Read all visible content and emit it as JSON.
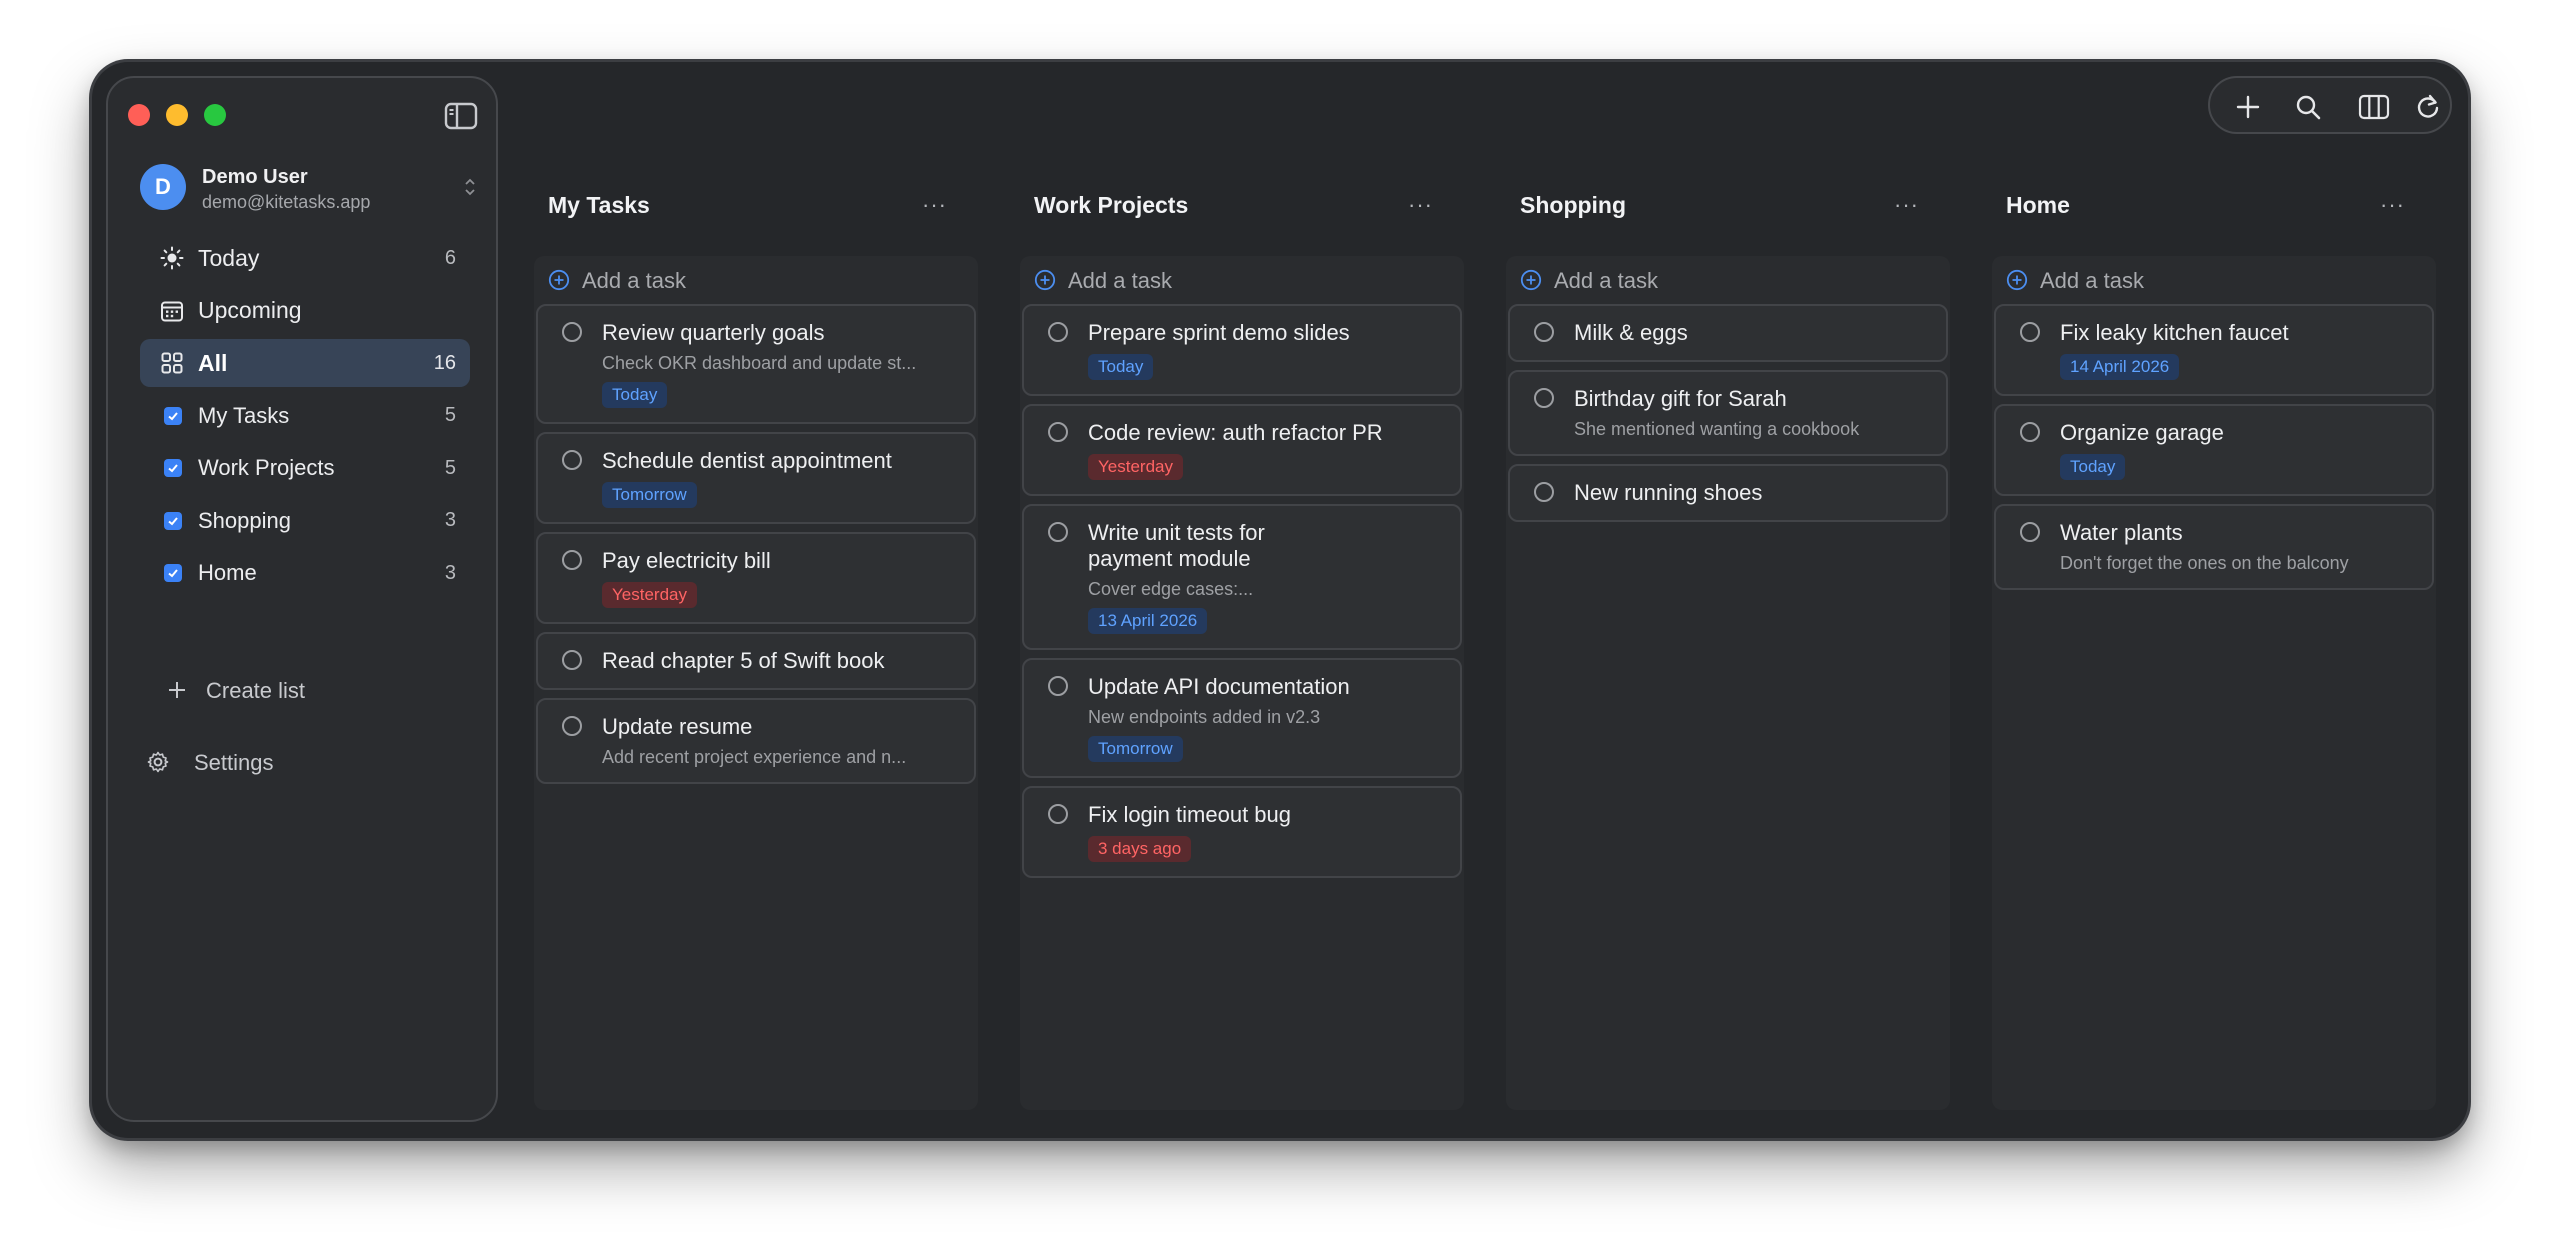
{
  "sidebar": {
    "account": {
      "initial": "D",
      "name": "Demo User",
      "email": "demo@kitetasks.app"
    },
    "smart_lists": [
      {
        "label": "Today",
        "count": "6",
        "icon": "sun-icon"
      },
      {
        "label": "Upcoming",
        "count": "",
        "icon": "calendar-icon"
      },
      {
        "label": "All",
        "count": "16",
        "icon": "grid-icon",
        "active": true
      }
    ],
    "lists": [
      {
        "label": "My Tasks",
        "count": "5"
      },
      {
        "label": "Work Projects",
        "count": "5"
      },
      {
        "label": "Shopping",
        "count": "3"
      },
      {
        "label": "Home",
        "count": "3"
      }
    ],
    "create_list": "Create list",
    "settings": "Settings"
  },
  "toolbar": {
    "icons": [
      "plus-icon",
      "search-icon",
      "columns-icon",
      "refresh-icon"
    ]
  },
  "colors": {
    "accent": "#3b82f6",
    "badge_blue": "#5fa2ff",
    "badge_red": "#ff6464",
    "avatar": "#4c8ef0"
  },
  "columns": [
    {
      "title": "My Tasks",
      "more": "···",
      "add_task": "Add a task",
      "tasks": [
        {
          "title": "Review quarterly goals",
          "note": "Check OKR dashboard and update st...",
          "badge": "Today",
          "badge_color": "blue"
        },
        {
          "title": "Schedule dentist appointment",
          "note": "",
          "badge": "Tomorrow",
          "badge_color": "blue"
        },
        {
          "title": "Pay electricity bill",
          "note": "",
          "badge": "Yesterday",
          "badge_color": "red"
        },
        {
          "title": "Read chapter 5 of Swift book",
          "note": "",
          "badge": "",
          "badge_color": ""
        },
        {
          "title": "Update resume",
          "note": "Add recent project experience and n...",
          "badge": "",
          "badge_color": ""
        }
      ]
    },
    {
      "title": "Work Projects",
      "more": "···",
      "add_task": "Add a task",
      "tasks": [
        {
          "title": "Prepare sprint demo slides",
          "note": "",
          "badge": "Today",
          "badge_color": "blue"
        },
        {
          "title": "Code review: auth refactor PR",
          "note": "",
          "badge": "Yesterday",
          "badge_color": "red"
        },
        {
          "title": "Write unit tests for\npayment module",
          "note": "Cover edge cases:...",
          "badge": "13 April 2026",
          "badge_color": "blue"
        },
        {
          "title": "Update API documentation",
          "note": "New endpoints added in v2.3",
          "badge": "Tomorrow",
          "badge_color": "blue"
        },
        {
          "title": "Fix login timeout bug",
          "note": "",
          "badge": "3 days ago",
          "badge_color": "red"
        }
      ]
    },
    {
      "title": "Shopping",
      "more": "···",
      "add_task": "Add a task",
      "tasks": [
        {
          "title": "Milk & eggs",
          "note": "",
          "badge": "",
          "badge_color": ""
        },
        {
          "title": "Birthday gift for Sarah",
          "note": "She mentioned wanting a cookbook",
          "badge": "",
          "badge_color": ""
        },
        {
          "title": "New running shoes",
          "note": "",
          "badge": "",
          "badge_color": ""
        }
      ]
    },
    {
      "title": "Home",
      "more": "···",
      "add_task": "Add a task",
      "tasks": [
        {
          "title": "Fix leaky kitchen faucet",
          "note": "",
          "badge": "14 April 2026",
          "badge_color": "blue"
        },
        {
          "title": "Organize garage",
          "note": "",
          "badge": "Today",
          "badge_color": "blue"
        },
        {
          "title": "Water plants",
          "note": "Don't forget the ones on the balcony",
          "badge": "",
          "badge_color": ""
        }
      ]
    }
  ]
}
